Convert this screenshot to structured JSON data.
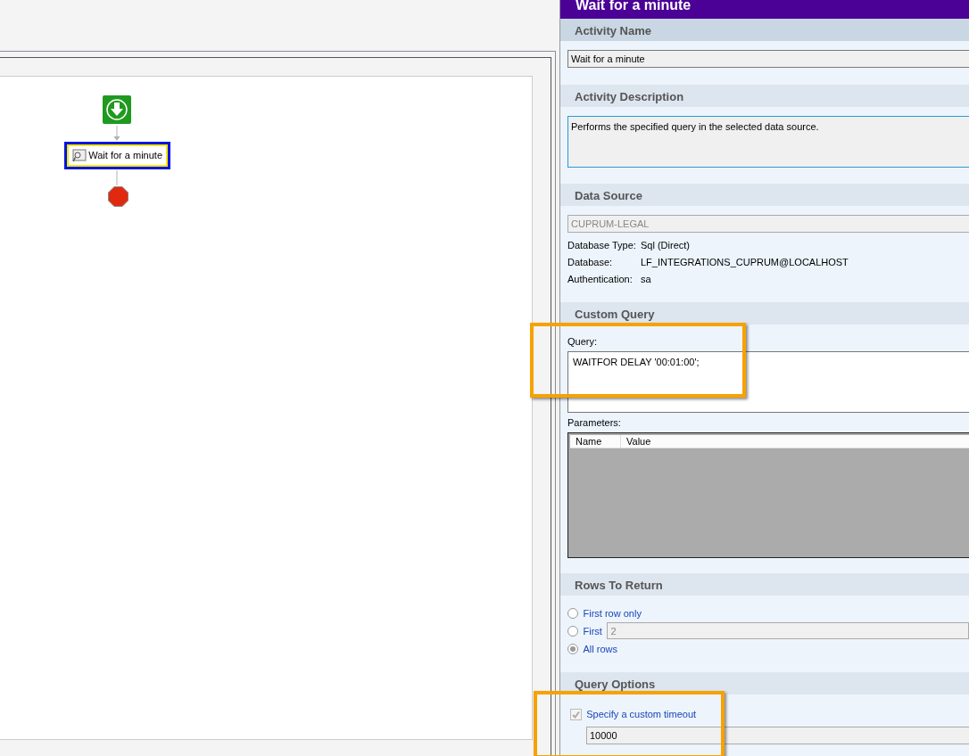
{
  "diagram": {
    "nodes": [
      {
        "kind": "start"
      },
      {
        "kind": "activity",
        "label": "Wait for a minute",
        "selected": true
      },
      {
        "kind": "end"
      }
    ]
  },
  "panel": {
    "title": "Wait for a minute",
    "activity_name": {
      "heading": "Activity Name",
      "value": "Wait for a minute"
    },
    "activity_description": {
      "heading": "Activity Description",
      "value": "Performs the specified query in the selected data source."
    },
    "data_source": {
      "heading": "Data Source",
      "value": "CUPRUM-LEGAL",
      "details": [
        {
          "label": "Database Type:",
          "value": "Sql (Direct)"
        },
        {
          "label": "Database:",
          "value": "LF_INTEGRATIONS_CUPRUM@LOCALHOST"
        },
        {
          "label": "Authentication:",
          "value": "sa"
        }
      ]
    },
    "custom_query": {
      "heading": "Custom Query",
      "query_label": "Query:",
      "query": "WAITFOR DELAY '00:01:00';",
      "parameters_label": "Parameters:",
      "parameter_columns": [
        "Name",
        "Value"
      ]
    },
    "rows_to_return": {
      "heading": "Rows To Return",
      "options": [
        {
          "label": "First row only",
          "selected": false
        },
        {
          "label": "First",
          "selected": false,
          "value": "2"
        },
        {
          "label": "All rows",
          "selected": true
        }
      ]
    },
    "query_options": {
      "heading": "Query Options",
      "options": [
        {
          "label": "Specify a custom timeout",
          "checked": true,
          "value": "10000"
        }
      ]
    }
  }
}
